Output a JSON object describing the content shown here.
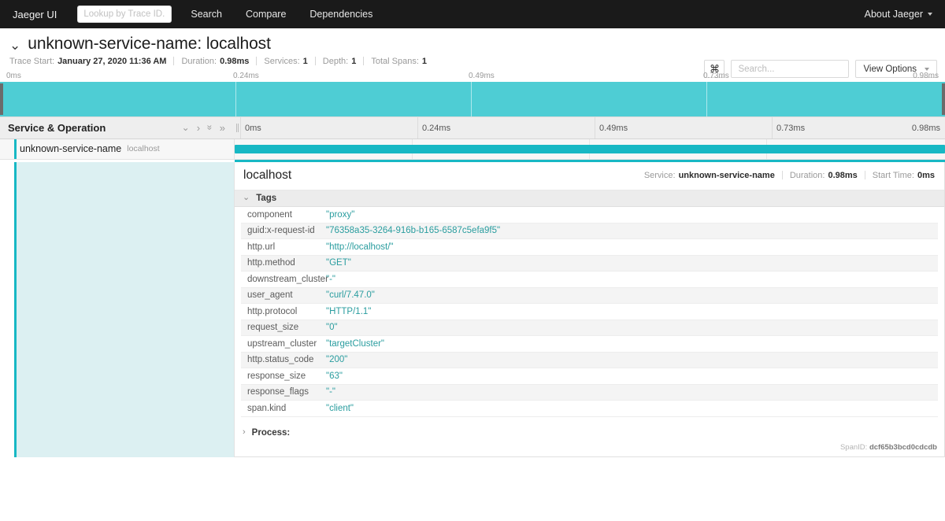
{
  "navbar": {
    "brand": "Jaeger UI",
    "lookup_placeholder": "Lookup by Trace ID...",
    "lookup_value": "",
    "links": [
      {
        "label": "Search"
      },
      {
        "label": "Compare"
      },
      {
        "label": "Dependencies"
      }
    ],
    "about": "About Jaeger"
  },
  "trace": {
    "title": "unknown-service-name: localhost",
    "collapse_chevron": "⌄",
    "meta": [
      {
        "label": "Trace Start:",
        "value": "January 27, 2020 11:36 AM"
      },
      {
        "label": "Duration:",
        "value": "0.98ms"
      },
      {
        "label": "Services:",
        "value": "1"
      },
      {
        "label": "Depth:",
        "value": "1"
      },
      {
        "label": "Total Spans:",
        "value": "1"
      }
    ],
    "controls": {
      "shortcut_key": "⌘",
      "search_placeholder": "Search...",
      "search_value": "",
      "view_options_label": "View Options"
    }
  },
  "minimap": {
    "ticks": [
      "0ms",
      "0.24ms",
      "0.49ms",
      "0.73ms",
      "0.98ms"
    ],
    "selection_color": "#4ecdd4"
  },
  "timeline_header": {
    "column_title": "Service & Operation",
    "collapse_controls": [
      {
        "name": "collapse-one-icon",
        "glyph": "⌄"
      },
      {
        "name": "expand-one-icon",
        "glyph": "›"
      },
      {
        "name": "collapse-all-icon",
        "glyph": "»"
      },
      {
        "name": "expand-all-icon",
        "glyph": "»"
      }
    ],
    "ticks": [
      "0ms",
      "0.24ms",
      "0.49ms",
      "0.73ms",
      "0.98ms"
    ]
  },
  "spans": [
    {
      "service": "unknown-service-name",
      "operation": "localhost",
      "bar_start_pct": 0,
      "bar_width_pct": 100,
      "color": "#17b8c4"
    }
  ],
  "span_detail": {
    "title": "localhost",
    "meta": [
      {
        "label": "Service:",
        "value": "unknown-service-name"
      },
      {
        "label": "Duration:",
        "value": "0.98ms"
      },
      {
        "label": "Start Time:",
        "value": "0ms"
      }
    ],
    "tags_section": {
      "label": "Tags",
      "expanded": true,
      "chevron": "⌄"
    },
    "tags": [
      {
        "key": "component",
        "value": "\"proxy\""
      },
      {
        "key": "guid:x-request-id",
        "value": "\"76358a35-3264-916b-b165-6587c5efa9f5\""
      },
      {
        "key": "http.url",
        "value": "\"http://localhost/\""
      },
      {
        "key": "http.method",
        "value": "\"GET\""
      },
      {
        "key": "downstream_cluster",
        "value": "\"-\""
      },
      {
        "key": "user_agent",
        "value": "\"curl/7.47.0\""
      },
      {
        "key": "http.protocol",
        "value": "\"HTTP/1.1\""
      },
      {
        "key": "request_size",
        "value": "\"0\""
      },
      {
        "key": "upstream_cluster",
        "value": "\"targetCluster\""
      },
      {
        "key": "http.status_code",
        "value": "\"200\""
      },
      {
        "key": "response_size",
        "value": "\"63\""
      },
      {
        "key": "response_flags",
        "value": "\"-\""
      },
      {
        "key": "span.kind",
        "value": "\"client\""
      }
    ],
    "process_section": {
      "label": "Process:",
      "expanded": false,
      "chevron": "›"
    },
    "span_id_label": "SpanID:",
    "span_id": "dcf65b3bcd0cdcdb"
  }
}
